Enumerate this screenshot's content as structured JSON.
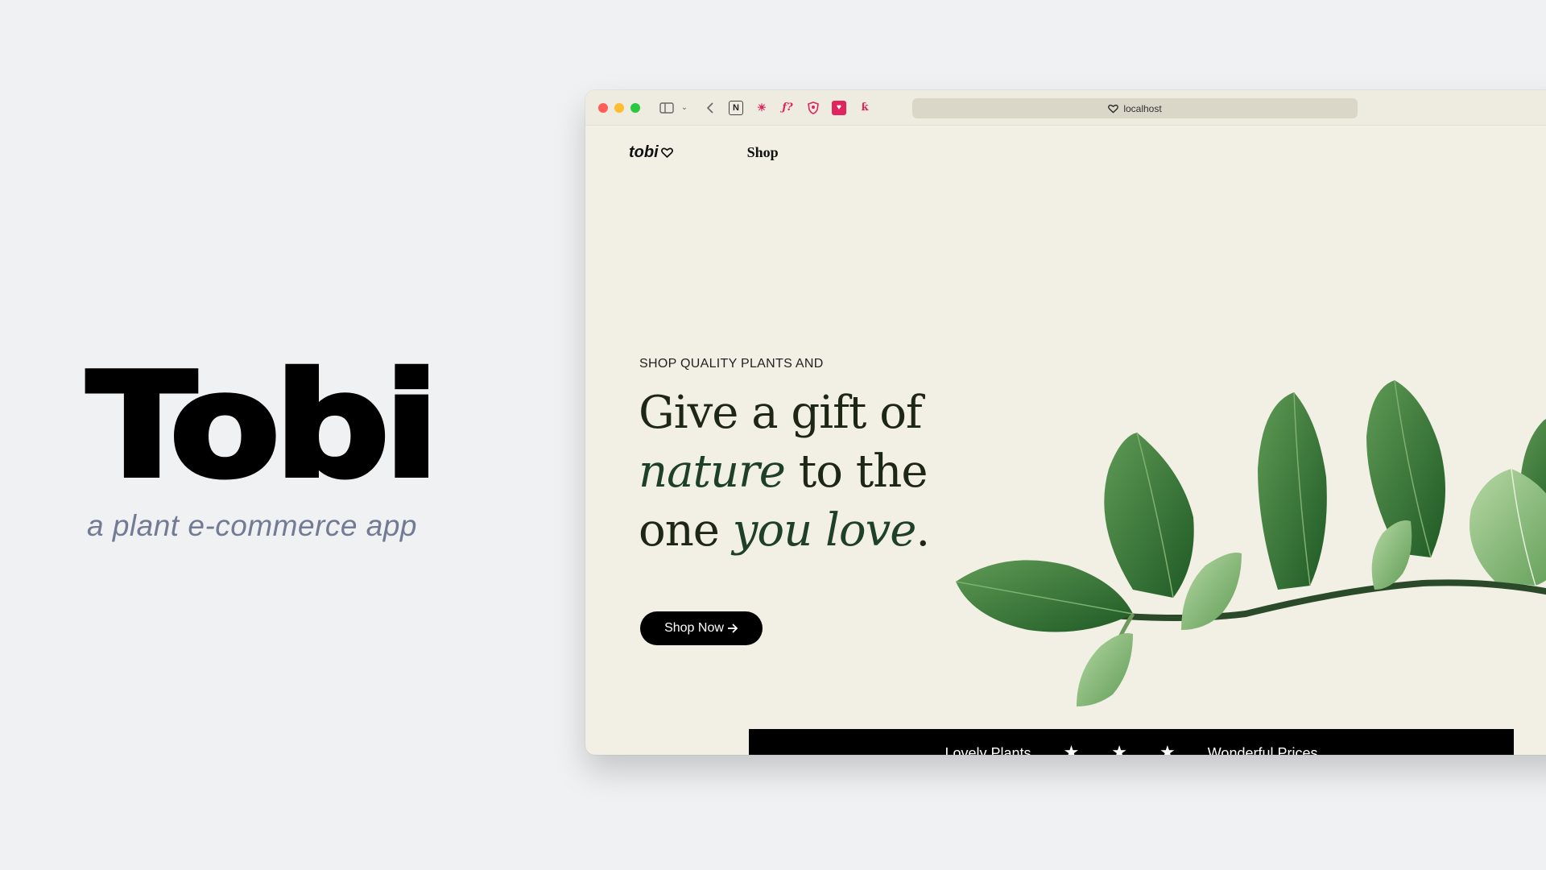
{
  "brand": {
    "title": "Tobi",
    "subtitle": "a plant e-commerce app"
  },
  "browser": {
    "address": "localhost",
    "extensions": [
      "notion-icon",
      "sun-extension-icon",
      "font-extension-icon",
      "shield-extension-icon",
      "pocket-extension-icon",
      "honey-extension-icon"
    ]
  },
  "site": {
    "logo_text": "tobi",
    "nav_shop": "Shop",
    "hero": {
      "eyebrow": "SHOP QUALITY PLANTS AND",
      "line1": "Give a gift of",
      "line2_em": "nature",
      "line2_rest": "to the",
      "line3_start": "one",
      "line3_em": "you love",
      "line3_end": ".",
      "cta": "Shop Now"
    },
    "marquee": {
      "left": "Lovely Plants",
      "right": "Wonderful Prices",
      "star": "★"
    }
  },
  "colors": {
    "page_bg": "#f0f1f3",
    "site_bg": "#f2f0e4",
    "heading": "#1e2716",
    "accent": "#1f4028",
    "subtitle": "#727b93"
  }
}
